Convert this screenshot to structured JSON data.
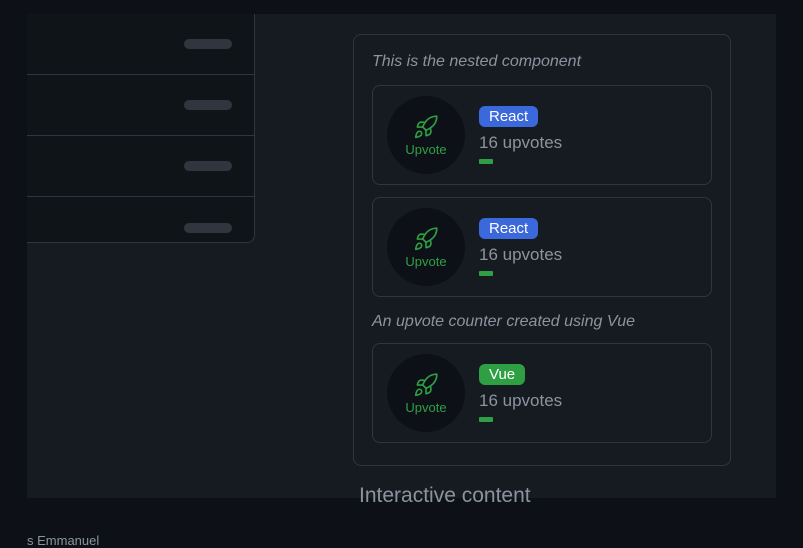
{
  "panel": {
    "title": "This is the nested component",
    "cards": [
      {
        "framework": "React",
        "upvote_count": "16 upvotes",
        "upvote_label": "Upvote"
      },
      {
        "framework": "React",
        "upvote_count": "16 upvotes",
        "upvote_label": "Upvote"
      }
    ],
    "vue_desc": "An upvote counter created using Vue",
    "vue_card": {
      "framework": "Vue",
      "upvote_count": "16 upvotes",
      "upvote_label": "Upvote"
    }
  },
  "section_heading": "Interactive content",
  "footer": "s Emmanuel"
}
